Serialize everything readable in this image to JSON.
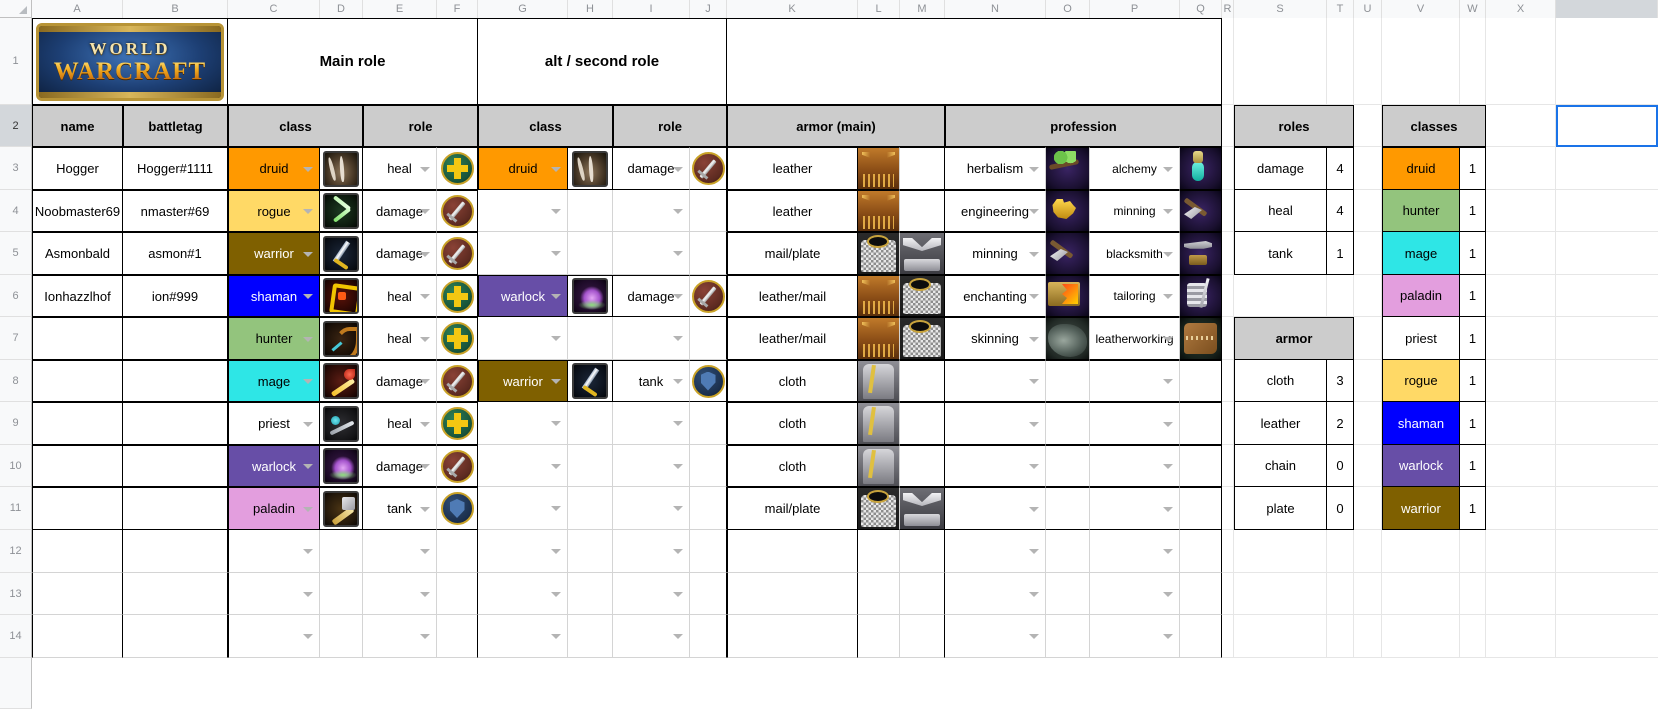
{
  "app": {
    "type": "spreadsheet",
    "logo": {
      "line1": "WORLD",
      "line2": "WARCRAFT"
    }
  },
  "columns": [
    "A",
    "B",
    "C",
    "D",
    "E",
    "F",
    "G",
    "H",
    "I",
    "J",
    "K",
    "L",
    "M",
    "N",
    "O",
    "P",
    "Q",
    "R",
    "S",
    "T",
    "U",
    "V",
    "W",
    "X"
  ],
  "selected_column": "Y",
  "rows": [
    "1",
    "2",
    "3",
    "4",
    "5",
    "6",
    "7",
    "8",
    "9",
    "10",
    "11",
    "12",
    "13",
    "14"
  ],
  "selected_row": "2",
  "group_headers": {
    "main_role": "Main role",
    "alt_role": "alt / second role"
  },
  "headers": {
    "name": "name",
    "battletag": "battletag",
    "main_class": "class",
    "main_role": "role",
    "alt_class": "class",
    "alt_role": "role",
    "armor_main": "armor (main)",
    "profession": "profession",
    "roles": "roles",
    "armor": "armor",
    "classes": "classes"
  },
  "roster": [
    {
      "row": "3",
      "name": "Hogger",
      "battletag": "Hogger#1111",
      "main_class": "druid",
      "main_class_icon": "druid-claw-icon",
      "main_role": "heal",
      "main_role_icon": "heal-icon",
      "alt_class": "druid",
      "alt_class_icon": "druid-claw-icon",
      "alt_role": "damage",
      "alt_role_icon": "damage-icon",
      "armor": "leather",
      "armor_icons": [
        "leather-armor-icon",
        ""
      ],
      "profession1": "herbalism",
      "profession1_icon": "herbalism-icon",
      "profession2": "alchemy",
      "profession2_icon": "alchemy-icon"
    },
    {
      "row": "4",
      "name": "Noobmaster69",
      "battletag": "nmaster#69",
      "main_class": "rogue",
      "main_class_icon": "rogue-dagger-icon",
      "main_role": "damage",
      "main_role_icon": "damage-icon",
      "alt_class": "",
      "alt_class_icon": "",
      "alt_role": "",
      "alt_role_icon": "",
      "armor": "leather",
      "armor_icons": [
        "leather-armor-icon",
        ""
      ],
      "profession1": "engineering",
      "profession1_icon": "engineering-icon",
      "profession2": "minning",
      "profession2_icon": "mining-icon"
    },
    {
      "row": "5",
      "name": "Asmonbald",
      "battletag": "asmon#1",
      "main_class": "warrior",
      "main_class_icon": "warrior-sword-icon",
      "main_role": "damage",
      "main_role_icon": "damage-icon",
      "alt_class": "",
      "alt_class_icon": "",
      "alt_role": "",
      "alt_role_icon": "",
      "armor": "mail/plate",
      "armor_icons": [
        "mail-armor-icon",
        "plate-armor-icon"
      ],
      "profession1": "minning",
      "profession1_icon": "mining-icon",
      "profession2": "blacksmith",
      "profession2_icon": "blacksmith-icon"
    },
    {
      "row": "6",
      "name": "Ionhazzlhof",
      "battletag": "ion#999",
      "main_class": "shaman",
      "main_class_icon": "shaman-totem-icon",
      "main_role": "heal",
      "main_role_icon": "heal-icon",
      "alt_class": "warlock",
      "alt_class_icon": "warlock-curse-icon",
      "alt_role": "damage",
      "alt_role_icon": "damage-icon",
      "armor": "leather/mail",
      "armor_icons": [
        "leather-armor-icon",
        "mail-armor-icon"
      ],
      "profession1": "enchanting",
      "profession1_icon": "enchanting-icon",
      "profession2": "tailoring",
      "profession2_icon": "tailoring-icon"
    },
    {
      "row": "7",
      "name": "",
      "battletag": "",
      "main_class": "hunter",
      "main_class_icon": "hunter-bow-icon",
      "main_role": "heal",
      "main_role_icon": "heal-icon",
      "alt_class": "",
      "alt_class_icon": "",
      "alt_role": "",
      "alt_role_icon": "",
      "armor": "leather/mail",
      "armor_icons": [
        "leather-armor-icon",
        "mail-armor-icon"
      ],
      "profession1": "skinning",
      "profession1_icon": "skinning-icon",
      "profession2": "leatherworking",
      "profession2_icon": "leatherworking-icon"
    },
    {
      "row": "8",
      "name": "",
      "battletag": "",
      "main_class": "mage",
      "main_class_icon": "mage-staff-icon",
      "main_role": "damage",
      "main_role_icon": "damage-icon",
      "alt_class": "warrior",
      "alt_class_icon": "warrior-sword-icon",
      "alt_role": "tank",
      "alt_role_icon": "tank-icon",
      "armor": "cloth",
      "armor_icons": [
        "cloth-armor-icon",
        ""
      ],
      "profession1": "",
      "profession1_icon": "",
      "profession2": "",
      "profession2_icon": ""
    },
    {
      "row": "9",
      "name": "",
      "battletag": "",
      "main_class": "priest",
      "main_class_icon": "priest-wand-icon",
      "main_role": "heal",
      "main_role_icon": "heal-icon",
      "alt_class": "",
      "alt_class_icon": "",
      "alt_role": "",
      "alt_role_icon": "",
      "armor": "cloth",
      "armor_icons": [
        "cloth-armor-icon",
        ""
      ],
      "profession1": "",
      "profession1_icon": "",
      "profession2": "",
      "profession2_icon": ""
    },
    {
      "row": "10",
      "name": "",
      "battletag": "",
      "main_class": "warlock",
      "main_class_icon": "warlock-curse-icon",
      "main_role": "damage",
      "main_role_icon": "damage-icon",
      "alt_class": "",
      "alt_class_icon": "",
      "alt_role": "",
      "alt_role_icon": "",
      "armor": "cloth",
      "armor_icons": [
        "cloth-armor-icon",
        ""
      ],
      "profession1": "",
      "profession1_icon": "",
      "profession2": "",
      "profession2_icon": ""
    },
    {
      "row": "11",
      "name": "",
      "battletag": "",
      "main_class": "paladin",
      "main_class_icon": "paladin-hammer-icon",
      "main_role": "tank",
      "main_role_icon": "tank-icon",
      "alt_class": "",
      "alt_class_icon": "",
      "alt_role": "",
      "alt_role_icon": "",
      "armor": "mail/plate",
      "armor_icons": [
        "mail-armor-icon",
        "plate-armor-icon"
      ],
      "profession1": "",
      "profession1_icon": "",
      "profession2": "",
      "profession2_icon": ""
    },
    {
      "row": "12",
      "name": "",
      "battletag": "",
      "main_class": "",
      "main_role": "",
      "alt_class": "",
      "alt_role": "",
      "armor": "",
      "armor_icons": [
        "",
        ""
      ],
      "profession1": "",
      "profession2": ""
    },
    {
      "row": "13",
      "name": "",
      "battletag": "",
      "main_class": "",
      "main_role": "",
      "alt_class": "",
      "alt_role": "",
      "armor": "",
      "armor_icons": [
        "",
        ""
      ],
      "profession1": "",
      "profession2": ""
    },
    {
      "row": "14",
      "name": "",
      "battletag": "",
      "main_class": "",
      "main_role": "",
      "alt_class": "",
      "alt_role": "",
      "armor": "",
      "armor_icons": [
        "",
        ""
      ],
      "profession1": "",
      "profession2": ""
    }
  ],
  "summary": {
    "roles": [
      {
        "label": "damage",
        "count": "4"
      },
      {
        "label": "heal",
        "count": "4"
      },
      {
        "label": "tank",
        "count": "1"
      }
    ],
    "armor": [
      {
        "label": "cloth",
        "count": "3"
      },
      {
        "label": "leather",
        "count": "2"
      },
      {
        "label": "chain",
        "count": "0"
      },
      {
        "label": "plate",
        "count": "0"
      }
    ],
    "classes": [
      {
        "label": "druid",
        "count": "1",
        "color": "#ff9900",
        "text": "#000000"
      },
      {
        "label": "hunter",
        "count": "1",
        "color": "#93c47d",
        "text": "#000000"
      },
      {
        "label": "mage",
        "count": "1",
        "color": "#2ee6e6",
        "text": "#000000"
      },
      {
        "label": "paladin",
        "count": "1",
        "color": "#e39ede",
        "text": "#000000"
      },
      {
        "label": "priest",
        "count": "1",
        "color": "#ffffff",
        "text": "#000000"
      },
      {
        "label": "rogue",
        "count": "1",
        "color": "#ffd966",
        "text": "#000000"
      },
      {
        "label": "shaman",
        "count": "1",
        "color": "#0000ff",
        "text": "#ffffff"
      },
      {
        "label": "warlock",
        "count": "1",
        "color": "#674ea7",
        "text": "#ffffff"
      },
      {
        "label": "warrior",
        "count": "1",
        "color": "#7f6000",
        "text": "#ffffff"
      }
    ]
  },
  "class_colors": {
    "druid": {
      "bg": "#ff9900",
      "fg": "#000000"
    },
    "rogue": {
      "bg": "#ffd966",
      "fg": "#000000"
    },
    "warrior": {
      "bg": "#7f6000",
      "fg": "#ffffff"
    },
    "shaman": {
      "bg": "#0000ff",
      "fg": "#ffffff"
    },
    "hunter": {
      "bg": "#93c47d",
      "fg": "#000000"
    },
    "mage": {
      "bg": "#2ee6e6",
      "fg": "#000000"
    },
    "priest": {
      "bg": "#ffffff",
      "fg": "#000000"
    },
    "warlock": {
      "bg": "#674ea7",
      "fg": "#ffffff"
    },
    "paladin": {
      "bg": "#e39ede",
      "fg": "#000000"
    }
  }
}
